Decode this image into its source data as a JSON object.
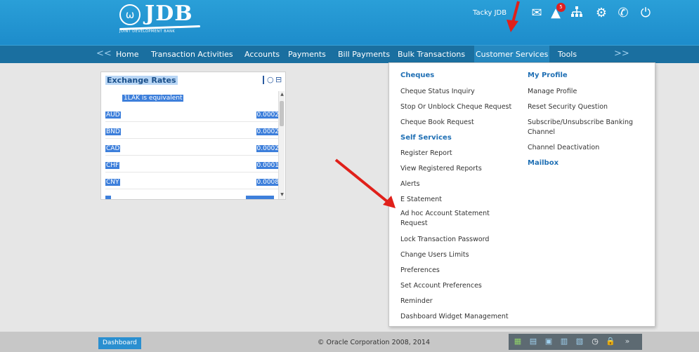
{
  "header": {
    "brand": "JDB",
    "brand_sub": "JOINT DEVELOPMENT BANK",
    "logo_mark": "ω",
    "user_name": "Tacky JDB",
    "notification_count": "5",
    "icons": [
      "mail-icon",
      "alert-icon",
      "sitemap-icon",
      "gear-icon",
      "phone-icon",
      "power-icon"
    ]
  },
  "nav": {
    "prev": "<<",
    "next": ">>",
    "items": [
      {
        "label": "Home"
      },
      {
        "label": "Transaction Activities"
      },
      {
        "label": "Accounts"
      },
      {
        "label": "Payments"
      },
      {
        "label": "Bill Payments"
      },
      {
        "label": "Bulk Transactions"
      },
      {
        "label": "Customer Services"
      },
      {
        "label": "Tools"
      }
    ]
  },
  "widget": {
    "title": "Exchange Rates",
    "equivalent": "1LAK is equivalent",
    "rows": [
      {
        "currency": "AUD",
        "value": "0.0002"
      },
      {
        "currency": "BND",
        "value": "0.0002"
      },
      {
        "currency": "CAD",
        "value": "0.0002"
      },
      {
        "currency": "CHF",
        "value": "0.0001"
      },
      {
        "currency": "CNY",
        "value": "0.0008"
      }
    ]
  },
  "menu": {
    "col1": {
      "cheques_head": "Cheques",
      "cheques": [
        "Cheque Status Inquiry",
        "Stop Or Unblock Cheque Request",
        "Cheque Book Request"
      ],
      "self_head": "Self Services",
      "self": [
        "Register Report",
        "View Registered Reports",
        "Alerts",
        "E Statement",
        "Ad hoc Account Statement",
        "Request",
        "Lock Transaction Password",
        "Change Users Limits",
        "Preferences",
        "Set Account Preferences",
        "Reminder",
        "Dashboard Widget Management"
      ]
    },
    "col2": {
      "profile_head": "My Profile",
      "profile": [
        "Manage Profile",
        "Reset Security Question",
        "Subscribe/Unsubscribe Banking",
        "Channel",
        "Channel Deactivation"
      ],
      "mailbox_head": "Mailbox"
    }
  },
  "footer": {
    "dashboard": "Dashboard",
    "copyright": "© Oracle Corporation 2008, 2014",
    "expand": "»"
  },
  "colors": {
    "header": "#1d8ccb",
    "nav": "#1a6fa0",
    "link": "#1f6fb4",
    "arrow": "#e0201a"
  }
}
